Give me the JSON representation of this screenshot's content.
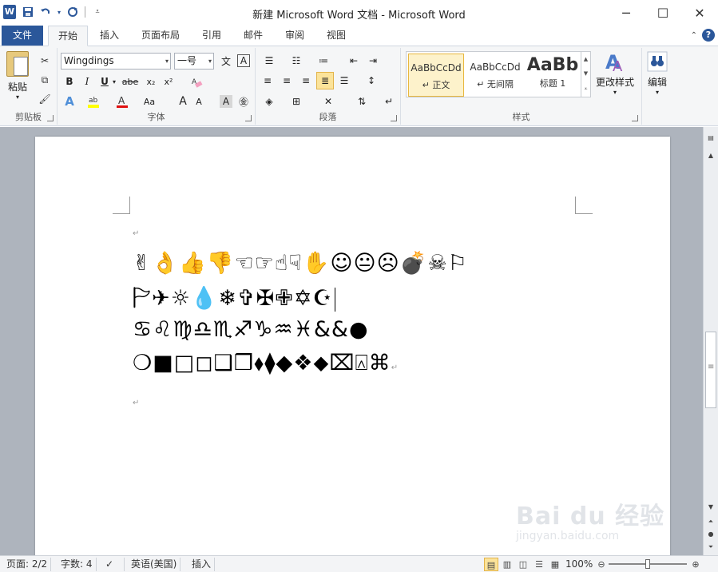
{
  "window": {
    "title": "新建 Microsoft Word 文档  -  Microsoft Word",
    "app_icon": "W",
    "controls": [
      "minimize",
      "maximize",
      "close"
    ]
  },
  "quick_access": {
    "save_icon": "save-icon",
    "undo_icon": "undo-icon",
    "redo_icon": "redo-icon"
  },
  "tabs": {
    "file": "文件",
    "items": [
      "开始",
      "插入",
      "页面布局",
      "引用",
      "邮件",
      "审阅",
      "视图"
    ],
    "active": "开始"
  },
  "ribbon": {
    "clipboard": {
      "label": "剪贴板",
      "paste": "粘贴"
    },
    "font": {
      "label": "字体",
      "font_name": "Wingdings",
      "font_size": "一号",
      "bold": "B",
      "italic": "I",
      "underline": "U",
      "strike": "abe",
      "subscript": "x₂",
      "superscript": "x²",
      "case": "Aa",
      "grow": "A",
      "shrink": "A"
    },
    "paragraph": {
      "label": "段落"
    },
    "styles": {
      "label": "样式",
      "items": [
        {
          "sample": "AaBbCcDd",
          "name": "↵ 正文",
          "selected": true
        },
        {
          "sample": "AaBbCcDd",
          "name": "↵ 无间隔",
          "selected": false
        },
        {
          "sample": "AaBb",
          "name": "标题 1",
          "selected": false
        }
      ],
      "change_styles": "更改样式"
    },
    "editing": {
      "label": "编辑"
    }
  },
  "document": {
    "lines": [
      "✌👌👍👎☜☞☝☟✋☺😐☹💣☠⚐",
      "🏱✈☼💧❄✞✠✙✡☪",
      "♋♌♍♎♏♐♑♒♓&&●",
      "❍■□◻❑❒⬧⧫◆❖⬥⌧⍓⌘"
    ]
  },
  "status": {
    "page": "页面: 2/2",
    "words": "字数: 4",
    "language": "英语(美国)",
    "mode": "插入",
    "zoom": "100%"
  },
  "watermark": {
    "brand": "Bai du 经验",
    "url": "jingyan.baidu.com"
  }
}
